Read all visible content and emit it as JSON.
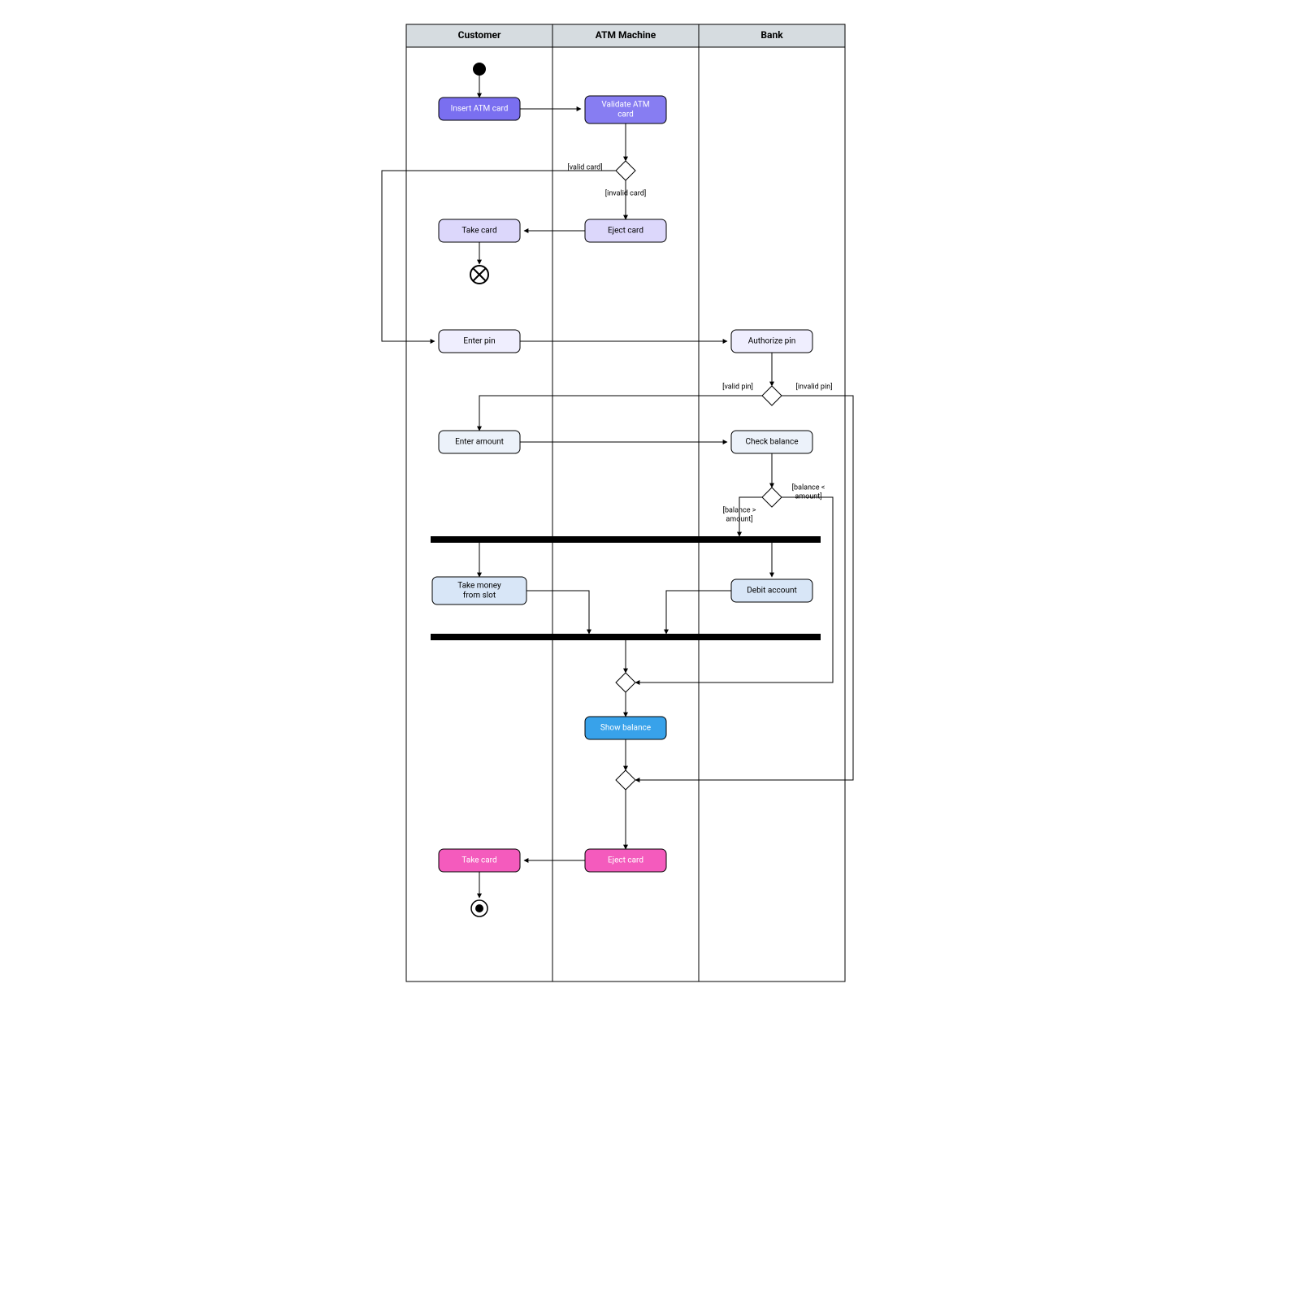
{
  "diagram": {
    "type": "uml-activity-swimlane",
    "lanes": [
      "Customer",
      "ATM Machine",
      "Bank"
    ],
    "lane_titles": {
      "customer": "Customer",
      "atm": "ATM Machine",
      "bank": "Bank"
    },
    "nodes": {
      "insert_card": "Insert ATM card",
      "validate_card": "Validate ATM card",
      "eject_card_1": "Eject card",
      "take_card_1": "Take card",
      "enter_pin": "Enter pin",
      "authorize_pin": "Authorize pin",
      "enter_amount": "Enter amount",
      "check_balance": "Check balance",
      "take_money": "Take money from slot",
      "debit_account": "Debit account",
      "show_balance": "Show balance",
      "eject_card_2": "Eject card",
      "take_card_2": "Take card"
    },
    "edges": {
      "valid_card": "[valid card]",
      "invalid_card": "[invalid card]",
      "valid_pin": "[valid pin]",
      "invalid_pin": "[invalid pin]",
      "balance_gt": "[balance > amount]",
      "balance_lt": "[balance < amount]"
    }
  }
}
